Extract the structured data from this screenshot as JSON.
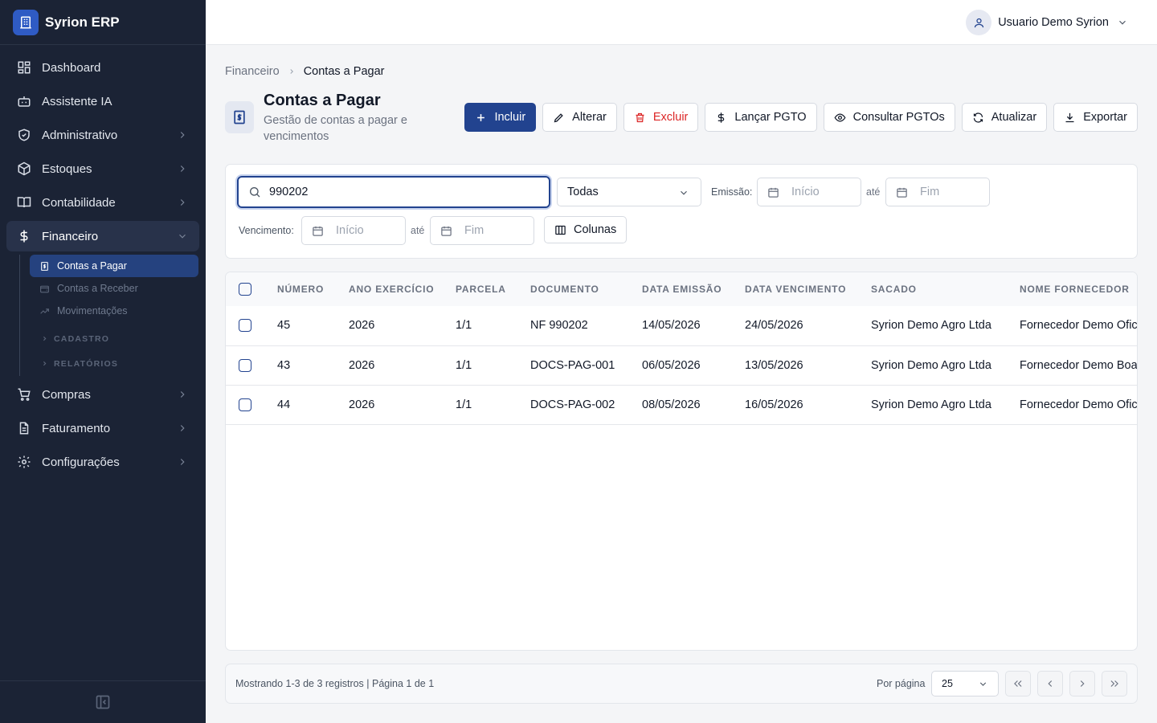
{
  "app": {
    "name": "Syrion ERP"
  },
  "sidebar": {
    "items": [
      {
        "label": "Dashboard",
        "icon": "dashboard-icon"
      },
      {
        "label": "Assistente IA",
        "icon": "bot-icon"
      },
      {
        "label": "Administrativo",
        "icon": "shield-icon"
      },
      {
        "label": "Estoques",
        "icon": "box-icon"
      },
      {
        "label": "Contabilidade",
        "icon": "book-icon"
      },
      {
        "label": "Financeiro",
        "icon": "dollar-icon"
      },
      {
        "label": "Compras",
        "icon": "cart-icon"
      },
      {
        "label": "Faturamento",
        "icon": "invoice-icon"
      },
      {
        "label": "Configurações",
        "icon": "gear-icon"
      }
    ],
    "financeiro_sub": [
      {
        "label": "Contas a Pagar"
      },
      {
        "label": "Contas a Receber"
      },
      {
        "label": "Movimentações"
      }
    ],
    "groups": [
      {
        "label": "CADASTRO"
      },
      {
        "label": "RELATÓRIOS"
      }
    ]
  },
  "header": {
    "user_name": "Usuario Demo Syrion"
  },
  "breadcrumb": {
    "root": "Financeiro",
    "current": "Contas a Pagar"
  },
  "page": {
    "title": "Contas a Pagar",
    "subtitle": "Gestão de contas a pagar e vencimentos"
  },
  "toolbar": {
    "incluir": "Incluir",
    "alterar": "Alterar",
    "excluir": "Excluir",
    "lancar": "Lançar PGTO",
    "consultar": "Consultar PGTOs",
    "atualizar": "Atualizar",
    "exportar": "Exportar"
  },
  "filters": {
    "search_value": "990202",
    "status_value": "Todas",
    "emissao_label": "Emissão:",
    "vencimento_label": "Vencimento:",
    "ate": "até",
    "inicio_placeholder": "Início",
    "fim_placeholder": "Fim",
    "colunas": "Colunas"
  },
  "table": {
    "headers": [
      "NÚMERO",
      "ANO EXERCÍCIO",
      "PARCELA",
      "DOCUMENTO",
      "DATA EMISSÃO",
      "DATA VENCIMENTO",
      "SACADO",
      "NOME FORNECEDOR"
    ],
    "rows": [
      [
        "45",
        "2026",
        "1/1",
        "NF 990202",
        "14/05/2026",
        "24/05/2026",
        "Syrion Demo Agro Ltda",
        "Fornecedor Demo Ofic"
      ],
      [
        "43",
        "2026",
        "1/1",
        "DOCS-PAG-001",
        "06/05/2026",
        "13/05/2026",
        "Syrion Demo Agro Ltda",
        "Fornecedor Demo Boa"
      ],
      [
        "44",
        "2026",
        "1/1",
        "DOCS-PAG-002",
        "08/05/2026",
        "16/05/2026",
        "Syrion Demo Agro Ltda",
        "Fornecedor Demo Ofic"
      ]
    ]
  },
  "pager": {
    "info": "Mostrando 1-3 de 3 registros | Página 1 de 1",
    "per_page_label": "Por página",
    "per_page_value": "25"
  },
  "colors": {
    "primary": "#22438f",
    "sidebar_bg": "#1b2335",
    "danger": "#dc2626"
  }
}
